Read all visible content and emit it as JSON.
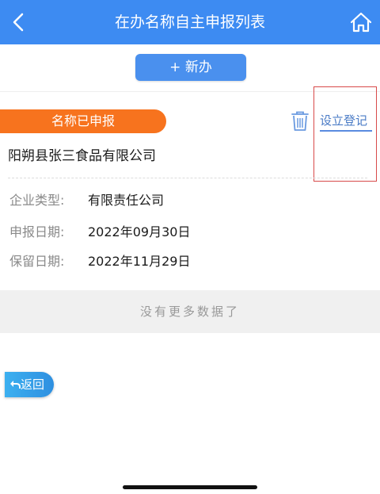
{
  "header": {
    "title": "在办名称自主申报列表",
    "back_icon": "chevron-left-icon",
    "home_icon": "home-icon",
    "background": "#3d8bf2"
  },
  "toolbar": {
    "new_label": "+ 新办"
  },
  "record": {
    "status_badge": "名称已申报",
    "badge_color": "#f7731e",
    "delete_icon": "trash-icon",
    "register_link": "设立登记",
    "company_name": "阳朔县张三食品有限公司",
    "fields": [
      {
        "label": "企业类型:",
        "value": "有限责任公司"
      },
      {
        "label": "申报日期:",
        "value": "2022年09月30日"
      },
      {
        "label": "保留日期:",
        "value": "2022年11月29日"
      }
    ]
  },
  "list_footer": {
    "no_more_text": "没有更多数据了"
  },
  "return_button": {
    "label": "返回",
    "icon": "return-arrow-icon"
  }
}
